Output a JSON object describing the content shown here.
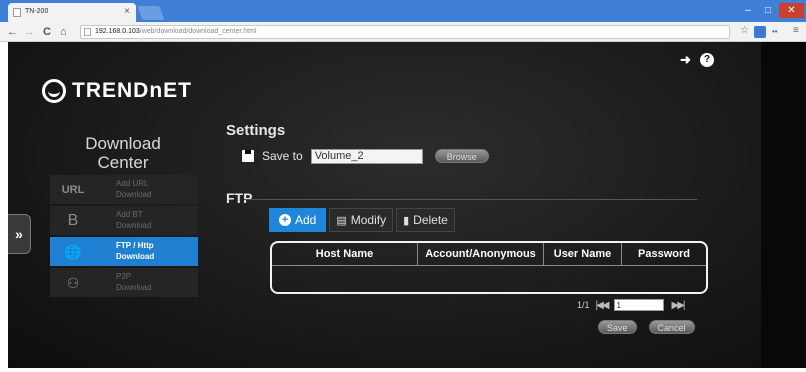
{
  "browser": {
    "tab_title": "TN-200",
    "tab_close": "×",
    "url_host": "192.168.0.103",
    "url_path": "/web/download/download_center.html",
    "back_icon": "←",
    "forward_icon": "→",
    "reload_icon": "C",
    "home_icon": "⌂",
    "menu_icon": "≡",
    "star_icon": "☆"
  },
  "header": {
    "brand": "TRENDnET",
    "logout_icon": "➜",
    "help_icon": "?"
  },
  "sidebar": {
    "toggle": "»",
    "title_line1": "Download",
    "title_line2": "Center",
    "items": [
      {
        "icon": "URL",
        "label_line1": "Add URL",
        "label_line2": "Download",
        "active": false
      },
      {
        "icon": "B",
        "label_line1": "Add BT",
        "label_line2": "Download",
        "active": false
      },
      {
        "icon": "🌐",
        "label_line1": "FTP / Http",
        "label_line2": "Download",
        "active": true
      },
      {
        "icon": "⚇",
        "label_line1": "P2P",
        "label_line2": "Download",
        "active": false
      }
    ]
  },
  "settings": {
    "heading": "Settings",
    "save_to_label": "Save to",
    "save_to_value": "Volume_2",
    "browse_label": "Browse"
  },
  "ftp": {
    "heading": "FTP",
    "add_label": "Add",
    "modify_label": "Modify",
    "delete_label": "Delete",
    "columns": [
      "Host Name",
      "Account/Anonymous",
      "User Name",
      "Password"
    ],
    "rows": []
  },
  "pagination": {
    "page_text": "1/1",
    "first_icon": "|◀◀",
    "last_icon": "▶▶|",
    "page_value": "1"
  },
  "footer": {
    "save_label": "Save",
    "cancel_label": "Cancel"
  }
}
